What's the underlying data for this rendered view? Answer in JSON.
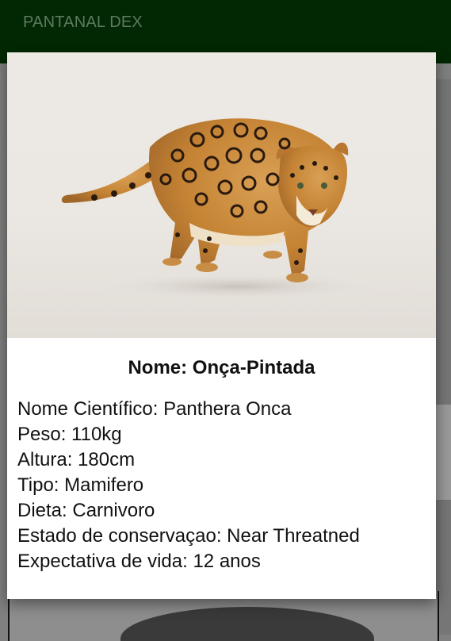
{
  "appbar": {
    "title": "PANTANAL DEX"
  },
  "modal": {
    "image_alt": "jaguar-photo",
    "name_label": "Nome: Onça-Pintada",
    "details": [
      "Nome Científico: Panthera Onca",
      "Peso: 110kg",
      "Altura: 180cm",
      "Tipo: Mamifero",
      "Dieta: Carnivoro",
      "Estado de conservaçao: Near Threatned",
      "Expectativa de vida: 12 anos"
    ]
  }
}
